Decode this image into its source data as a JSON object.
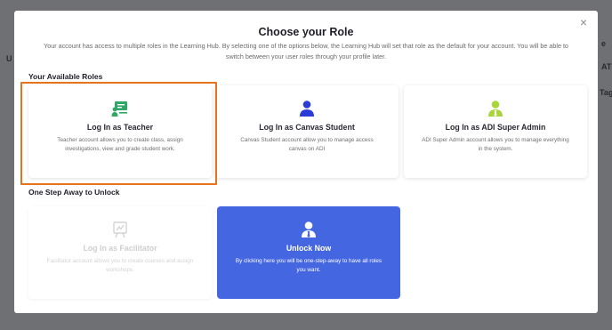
{
  "background": {
    "left_fragment": "U",
    "right_fragments": [
      "e",
      "ATI",
      "Tag"
    ]
  },
  "modal": {
    "close_glyph": "×",
    "title": "Choose your Role",
    "intro": "Your account has access to multiple roles in the Learning Hub. By selecting one of the options below, the Learning Hub will set that role as the default for your account. You will be able to switch between your user roles through your profile later."
  },
  "available": {
    "heading": "Your Available Roles",
    "roles": [
      {
        "label": "Log In as Teacher",
        "description": "Teacher account allows you to create class, assign investigations, view and grade student work.",
        "icon": "teacher-board-icon",
        "icon_color": "#2fa866",
        "selected": true
      },
      {
        "label": "Log In as Canvas Student",
        "description": "Canvas Student account allow you to manage access canvas on ADI",
        "icon": "user-icon",
        "icon_color": "#2b3bd6",
        "selected": false
      },
      {
        "label": "Log In as ADI Super Admin",
        "description": "ADI Super Admin account allows you to manage everything in the system.",
        "icon": "admin-user-icon",
        "icon_color": "#a8d63a",
        "selected": false
      }
    ]
  },
  "locked": {
    "heading": "One Step Away to Unlock",
    "facilitator": {
      "label": "Log In as Facilitator",
      "description": "Facilitator account allows you to create courses and assign workshops.",
      "icon": "easel-icon"
    },
    "unlock": {
      "label": "Unlock Now",
      "description": "By clicking here you will be one-step-away to have all roles you want.",
      "icon": "admin-user-icon"
    }
  },
  "colors": {
    "selection_outline": "#e8731f",
    "unlock_bg": "#4466e0",
    "overlay": "#6f7073"
  }
}
